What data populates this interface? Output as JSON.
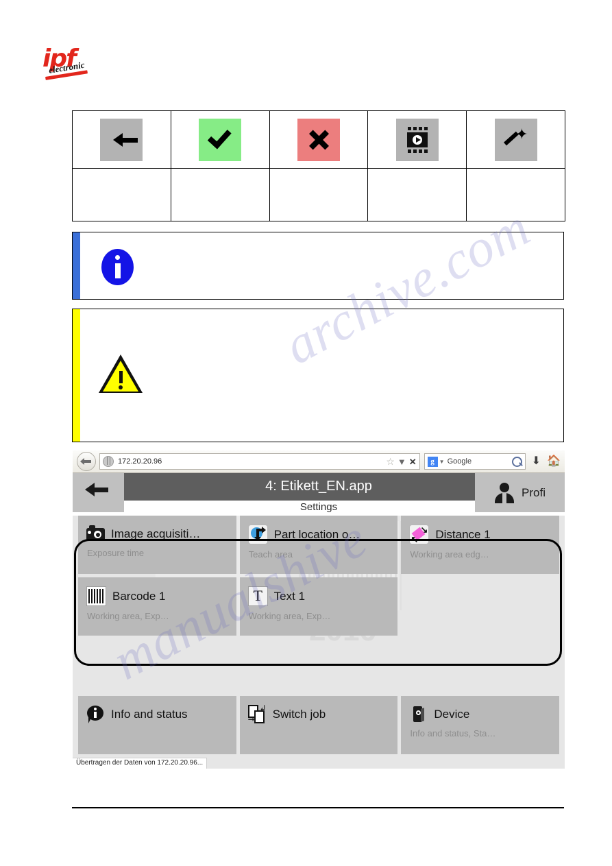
{
  "logo": {
    "primary": "ipf",
    "secondary": "electronic",
    "color": "#e2261c"
  },
  "icon_table": {
    "row_icons": [
      {
        "name": "back-arrow-icon",
        "glyph": "arrow-left",
        "tile_color": "#b3b3b3",
        "caption": ""
      },
      {
        "name": "confirm-check-icon",
        "glyph": "check",
        "tile_color": "#86ec86",
        "caption": ""
      },
      {
        "name": "cancel-cross-icon",
        "glyph": "cross",
        "tile_color": "#ec7e7e",
        "caption": ""
      },
      {
        "name": "live-image-icon",
        "glyph": "film-play",
        "tile_color": "#b3b3b3",
        "caption": ""
      },
      {
        "name": "auto-setup-wand-icon",
        "glyph": "magic-wand",
        "tile_color": "#b3b3b3",
        "caption": ""
      }
    ],
    "row_empty": [
      "",
      "",
      "",
      "",
      ""
    ]
  },
  "notices": {
    "info": {
      "icon": "info-icon",
      "accent": "#3a6fd8",
      "text": ""
    },
    "warning": {
      "icon": "warning-triangle-icon",
      "accent": "#ffff00",
      "text": ""
    }
  },
  "browser": {
    "back_button": "back-arrow-icon",
    "url": "172.20.20.96",
    "url_icons": [
      "star-icon",
      "chevron-down-icon",
      "close-icon"
    ],
    "search": {
      "engine_badge": "g",
      "engine_label": "Google",
      "search_icon": "magnifier-icon"
    },
    "download_icon": "download-arrow-icon",
    "home_icon": "home-icon",
    "status_text": "Übertragen der Daten von 172.20.20.96..."
  },
  "app": {
    "header": {
      "back_label": "back-arrow-icon",
      "title": "4: Etikett_EN.app",
      "user_icon": "person-icon",
      "user_label": "Profi"
    },
    "subheader": "Settings",
    "background_watermark_year": "2016",
    "tiles": [
      [
        {
          "icon": "camera-icon",
          "title": "Image acquisiti…",
          "subtitle": "Exposure time"
        },
        {
          "icon": "part-location-icon",
          "title": "Part location o…",
          "subtitle": "Teach area"
        },
        {
          "icon": "distance-icon",
          "title": "Distance 1",
          "subtitle": "Working area edg…"
        }
      ],
      [
        {
          "icon": "barcode-icon",
          "title": "Barcode 1",
          "subtitle": "Working area, Exp…"
        },
        {
          "icon": "text-icon",
          "title": "Text 1",
          "subtitle": "Working area, Exp…"
        },
        {
          "icon": "",
          "title": "",
          "subtitle": ""
        }
      ]
    ],
    "bottom_tiles": [
      {
        "icon": "info-status-icon",
        "title": "Info and status",
        "subtitle": ""
      },
      {
        "icon": "switch-job-icon",
        "title": "Switch job",
        "subtitle": ""
      },
      {
        "icon": "device-icon",
        "title": "Device",
        "subtitle": "Info and status, Sta…"
      }
    ]
  },
  "watermarks": {
    "line1": "archive.com",
    "line2": "manualshive"
  }
}
